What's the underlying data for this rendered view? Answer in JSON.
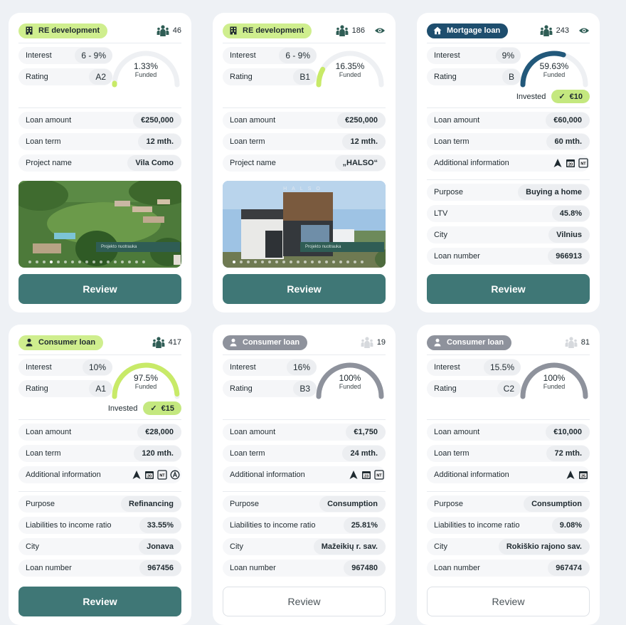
{
  "colors": {
    "green_badge": "#cfee8e",
    "navy_badge": "#1e4e6e",
    "gray_badge": "#8e929c",
    "button": "#3f7776",
    "gauge_green": "#c8ea68",
    "gauge_navy": "#22587a",
    "gauge_gray": "#8e929c"
  },
  "labels": {
    "interest": "Interest",
    "rating": "Rating",
    "funded": "Funded",
    "invested": "Invested",
    "loan_amount": "Loan amount",
    "loan_term": "Loan term",
    "project_name": "Project name",
    "additional_info": "Additional information",
    "purpose": "Purpose",
    "ltv": "LTV",
    "city": "City",
    "loan_number": "Loan number",
    "liabilities": "Liabilities to income ratio",
    "review": "Review"
  },
  "cards": [
    {
      "category": "RE development",
      "category_icon": "building-icon",
      "investors": "46",
      "interest": "6 - 9%",
      "rating": "A2",
      "funded": "1.33%",
      "funded_fraction": 0.0133,
      "loan_amount": "€250,000",
      "loan_term": "12 mth.",
      "project_name": "Vila Como",
      "photo_caption": "Projekto nuotrauka"
    },
    {
      "category": "RE development",
      "category_icon": "building-icon",
      "investors": "186",
      "interest": "6 - 9%",
      "rating": "B1",
      "funded": "16.35%",
      "funded_fraction": 0.1635,
      "loan_amount": "€250,000",
      "loan_term": "12 mth.",
      "project_name": "„HALSO“",
      "photo_caption": "Projekto nuotrauka",
      "photo_sign": "HALSO"
    },
    {
      "category": "Mortgage loan",
      "category_icon": "house-icon",
      "investors": "243",
      "interest": "9%",
      "rating": "B",
      "funded": "59.63%",
      "funded_fraction": 0.5963,
      "invested": "€10",
      "loan_amount": "€60,000",
      "loan_term": "60 mth.",
      "purpose": "Buying a home",
      "ltv": "45.8%",
      "city": "Vilnius",
      "loan_number": "966913",
      "date_badge": "20",
      "doc_badge": "NT"
    },
    {
      "category": "Consumer loan",
      "category_icon": "person-icon",
      "investors": "417",
      "interest": "10%",
      "rating": "A1",
      "funded": "97.5%",
      "funded_fraction": 0.975,
      "invested": "€15",
      "loan_amount": "€28,000",
      "loan_term": "120 mth.",
      "purpose": "Refinancing",
      "liabilities": "33.55%",
      "city": "Jonava",
      "loan_number": "967456",
      "date_badge": "20",
      "doc_badge": "NT"
    },
    {
      "category": "Consumer loan",
      "category_icon": "person-icon",
      "investors": "19",
      "interest": "16%",
      "rating": "B3",
      "funded": "100%",
      "funded_fraction": 1.0,
      "loan_amount": "€1,750",
      "loan_term": "24 mth.",
      "purpose": "Consumption",
      "liabilities": "25.81%",
      "city": "Mažeikių r. sav.",
      "loan_number": "967480",
      "date_badge": "23",
      "doc_badge": "NT"
    },
    {
      "category": "Consumer loan",
      "category_icon": "person-icon",
      "investors": "81",
      "interest": "15.5%",
      "rating": "C2",
      "funded": "100%",
      "funded_fraction": 1.0,
      "loan_amount": "€10,000",
      "loan_term": "72 mth.",
      "purpose": "Consumption",
      "liabilities": "9.08%",
      "city": "Rokiškio rajono sav.",
      "loan_number": "967474",
      "date_badge": "25"
    }
  ]
}
